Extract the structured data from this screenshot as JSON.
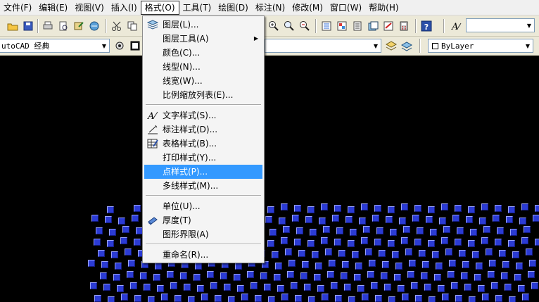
{
  "menubar": {
    "items": [
      {
        "label": "文件(F)"
      },
      {
        "label": "编辑(E)"
      },
      {
        "label": "视图(V)"
      },
      {
        "label": "插入(I)"
      },
      {
        "label": "格式(O)"
      },
      {
        "label": "工具(T)"
      },
      {
        "label": "绘图(D)"
      },
      {
        "label": "标注(N)"
      },
      {
        "label": "修改(M)"
      },
      {
        "label": "窗口(W)"
      },
      {
        "label": "帮助(H)"
      }
    ]
  },
  "toolbar2": {
    "workspace_value": "utoCAD 经典",
    "linetype_value": "ByLayer"
  },
  "format_menu": {
    "items": [
      {
        "label": "图层(L)...",
        "icon": "layers-icon"
      },
      {
        "label": "图层工具(A)",
        "submenu": true
      },
      {
        "label": "颜色(C)..."
      },
      {
        "label": "线型(N)..."
      },
      {
        "label": "线宽(W)..."
      },
      {
        "label": "比例缩放列表(E)..."
      },
      {
        "label": "文字样式(S)...",
        "icon": "text-style-icon"
      },
      {
        "label": "标注样式(D)...",
        "icon": "dimension-style-icon"
      },
      {
        "label": "表格样式(B)...",
        "icon": "table-style-icon"
      },
      {
        "label": "打印样式(Y)..."
      },
      {
        "label": "点样式(P)...",
        "highlighted": true
      },
      {
        "label": "多线样式(M)..."
      },
      {
        "label": "单位(U)..."
      },
      {
        "label": "厚度(T)",
        "icon": "thickness-icon"
      },
      {
        "label": "图形界限(A)"
      },
      {
        "label": "重命名(R)..."
      }
    ]
  },
  "colors": {
    "highlight": "#3399ff",
    "point_fill": "#2b3bd4",
    "canvas": "#000000"
  }
}
